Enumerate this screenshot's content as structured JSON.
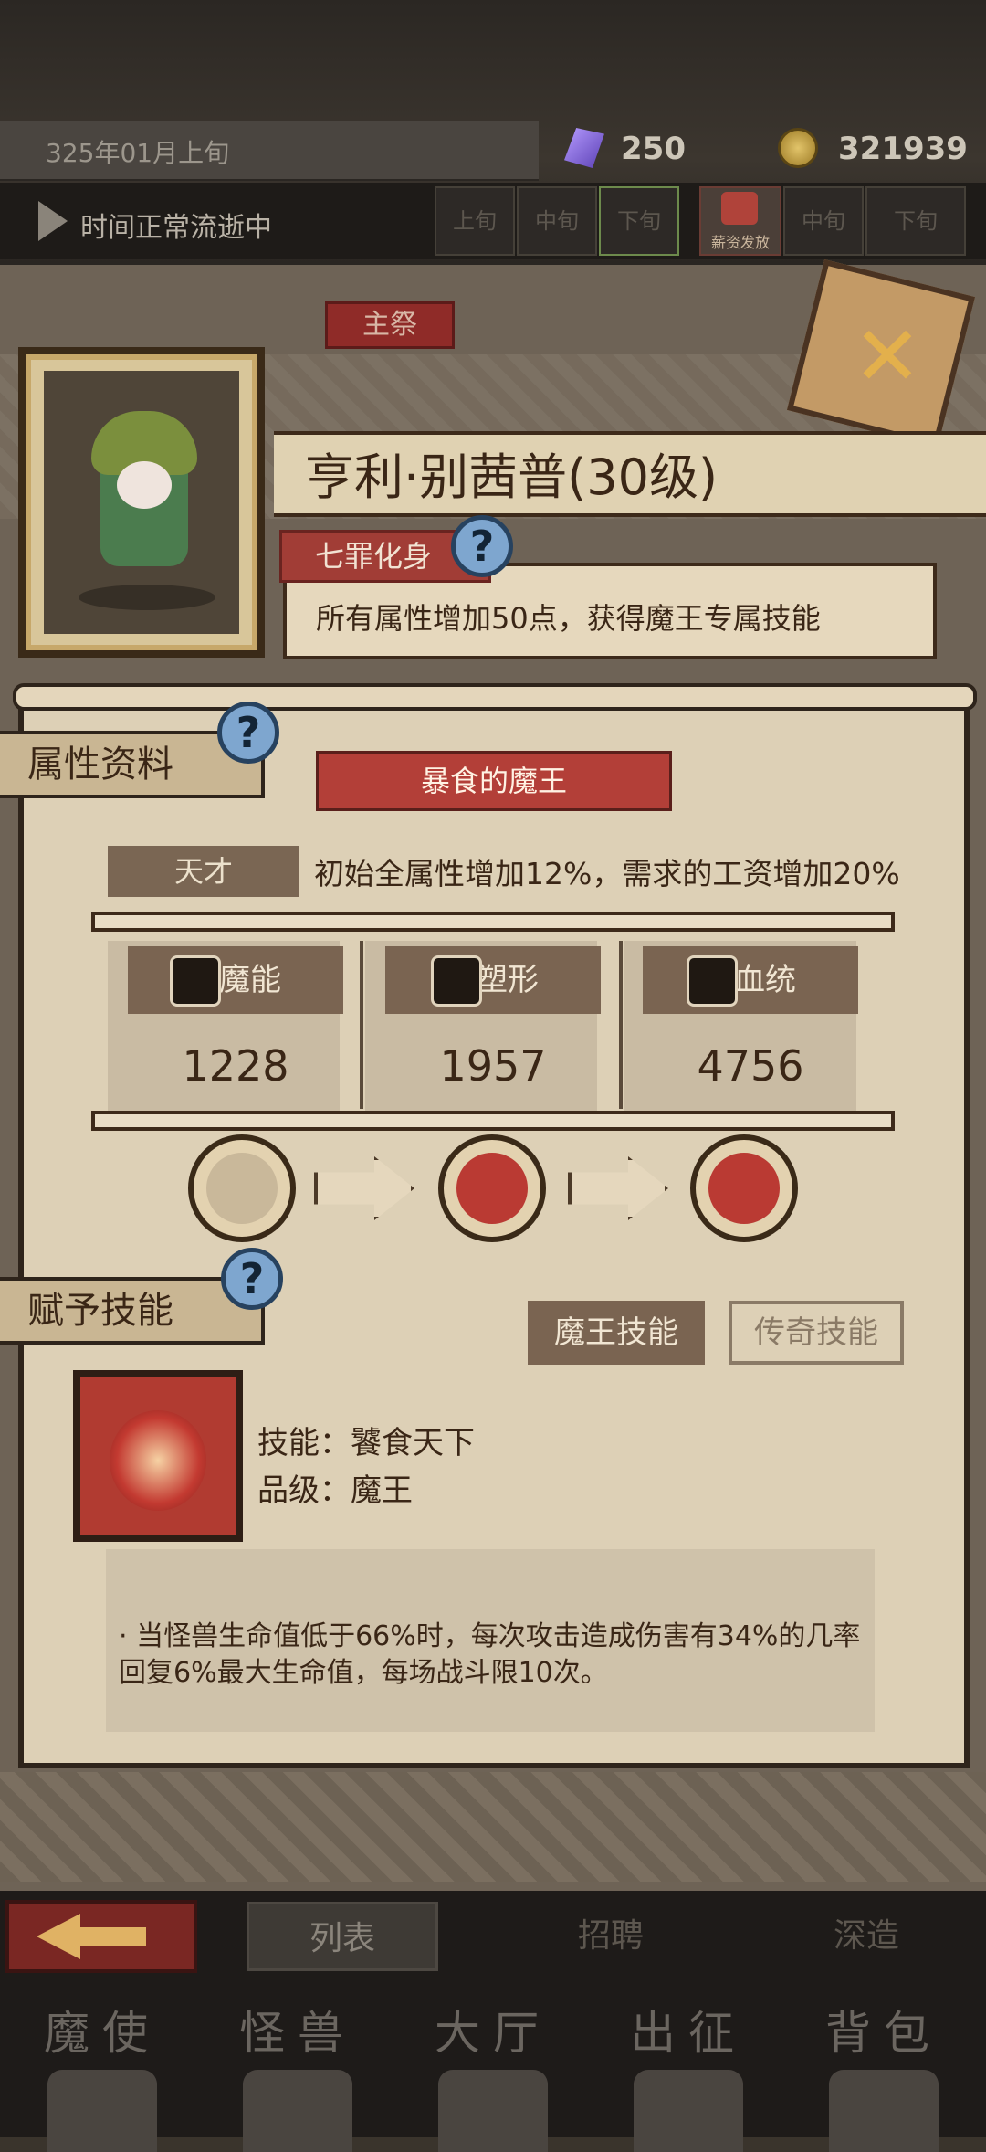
{
  "hud": {
    "date": "325年01月上旬",
    "crystal": "250",
    "gold": "321939",
    "time_status": "时间正常流逝中",
    "slots": [
      "上旬",
      "中旬",
      "下旬"
    ],
    "salary_label": "薪资发放",
    "salary_slots": [
      "中旬",
      "下旬"
    ]
  },
  "panel": {
    "tab_label": "主祭",
    "name": "亨利·别茜普(30级)",
    "title_tag": "七罪化身",
    "title_desc": "所有属性增加50点，获得魔王专属技能",
    "section_attr": "属性资料",
    "subtitle": "暴食的魔王",
    "talent_label": "天才",
    "talent_desc": "初始全属性增加12%，需求的工资增加20%",
    "stats": [
      {
        "label": "魔能",
        "value": "1228"
      },
      {
        "label": "塑形",
        "value": "1957"
      },
      {
        "label": "血统",
        "value": "4756"
      }
    ],
    "section_skill": "赋予技能",
    "btn_demon_skill": "魔王技能",
    "btn_legend_skill": "传奇技能",
    "skill_name_line": "技能：饕食天下",
    "skill_grade_line": "品级：魔王",
    "skill_desc": "·  当怪兽生命值低于66%时，每次攻击造成伤害有34%的几率回复6%最大生命值，每场战斗限10次。"
  },
  "bottom": {
    "subtabs": [
      "列表",
      "招聘",
      "深造"
    ],
    "nav": [
      "魔使",
      "怪兽",
      "大厅",
      "出征",
      "背包"
    ]
  },
  "colors": {
    "accent_red": "#b33f38",
    "parchment": "#ddd0b6",
    "ink": "#3a2616"
  }
}
